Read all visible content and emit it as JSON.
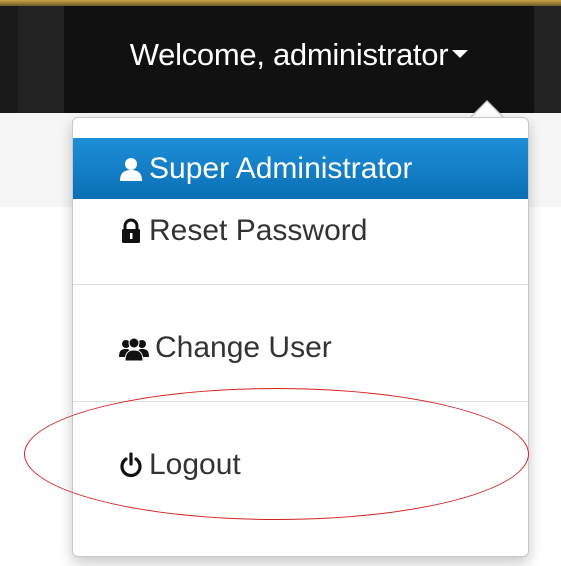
{
  "navbar": {
    "user_menu_label": "Welcome, administrator"
  },
  "dropdown": {
    "items": [
      {
        "label": "Super Administrator",
        "icon": "user-icon",
        "active": true
      },
      {
        "label": "Reset Password",
        "icon": "lock-icon",
        "active": false
      },
      {
        "label": "Change User",
        "icon": "users-icon",
        "active": false
      },
      {
        "label": "Logout",
        "icon": "power-icon",
        "active": false
      }
    ]
  },
  "colors": {
    "navbar_bg": "#222222",
    "active_item_bg": "#0b6fb5",
    "annotation": "#d62020"
  }
}
